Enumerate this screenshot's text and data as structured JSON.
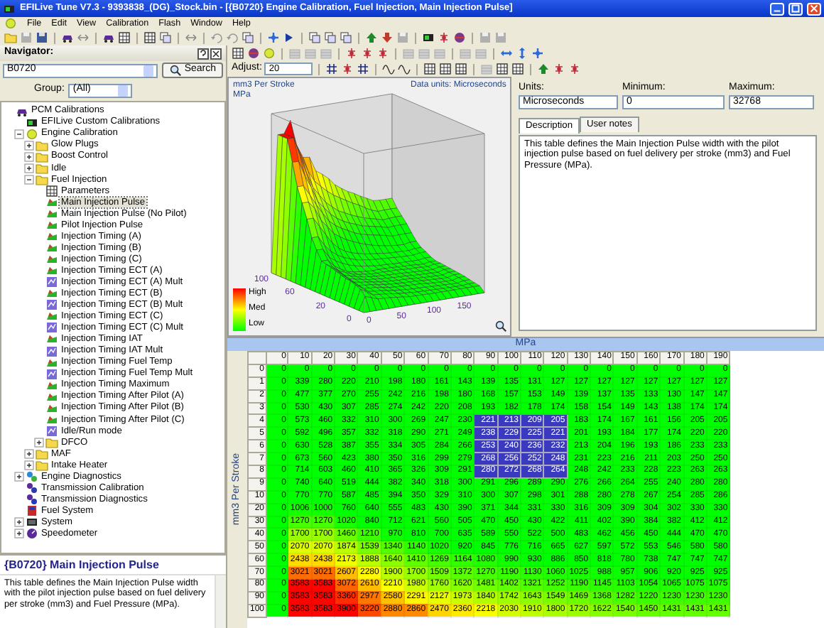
{
  "window": {
    "title": "EFILive Tune V7.3 - 9393838_(DG)_Stock.bin - [{B0720} Engine Calibration, Fuel Injection, Main Injection Pulse]"
  },
  "menu": [
    "File",
    "Edit",
    "View",
    "Calibration",
    "Flash",
    "Window",
    "Help"
  ],
  "navigator": {
    "title": "Navigator:",
    "search_value": "B0720",
    "search_button": "Search",
    "group_label": "Group:",
    "group_value": "(All)"
  },
  "tree": [
    {
      "label": "PCM Calibrations",
      "kind": "pcm",
      "selected": false,
      "children": [
        {
          "label": "EFILive Custom Calibrations",
          "kind": "custom",
          "selected": false
        },
        {
          "label": "Engine Calibration",
          "kind": "engine",
          "expanded": true,
          "selected": false,
          "children": [
            {
              "label": "Glow Plugs",
              "kind": "folder",
              "expanded": false,
              "selected": false
            },
            {
              "label": "Boost Control",
              "kind": "folder",
              "expanded": false,
              "selected": false
            },
            {
              "label": "Idle",
              "kind": "folder",
              "expanded": false,
              "selected": false
            },
            {
              "label": "Fuel Injection",
              "kind": "folder",
              "expanded": true,
              "selected": false,
              "children": [
                {
                  "label": "Parameters",
                  "kind": "grid",
                  "selected": false
                },
                {
                  "label": "Main Injection Pulse",
                  "kind": "map",
                  "selected": true
                },
                {
                  "label": "Main Injection Pulse (No Pilot)",
                  "kind": "map",
                  "selected": false
                },
                {
                  "label": "Pilot Injection Pulse",
                  "kind": "map",
                  "selected": false
                },
                {
                  "label": "Injection Timing (A)",
                  "kind": "map",
                  "selected": false
                },
                {
                  "label": "Injection Timing (B)",
                  "kind": "map",
                  "selected": false
                },
                {
                  "label": "Injection Timing (C)",
                  "kind": "map",
                  "selected": false
                },
                {
                  "label": "Injection Timing ECT (A)",
                  "kind": "map",
                  "selected": false
                },
                {
                  "label": "Injection Timing ECT (A) Mult",
                  "kind": "mult",
                  "selected": false
                },
                {
                  "label": "Injection Timing ECT (B)",
                  "kind": "map",
                  "selected": false
                },
                {
                  "label": "Injection Timing ECT (B) Mult",
                  "kind": "mult",
                  "selected": false
                },
                {
                  "label": "Injection Timing ECT (C)",
                  "kind": "map",
                  "selected": false
                },
                {
                  "label": "Injection Timing ECT (C) Mult",
                  "kind": "mult",
                  "selected": false
                },
                {
                  "label": "Injection Timing IAT",
                  "kind": "map",
                  "selected": false
                },
                {
                  "label": "Injection Timing IAT Mult",
                  "kind": "mult",
                  "selected": false
                },
                {
                  "label": "Injection Timing Fuel Temp",
                  "kind": "map",
                  "selected": false
                },
                {
                  "label": "Injection Timing Fuel Temp Mult",
                  "kind": "mult",
                  "selected": false
                },
                {
                  "label": "Injection Timing Maximum",
                  "kind": "map",
                  "selected": false
                },
                {
                  "label": "Injection Timing After Pilot (A)",
                  "kind": "map",
                  "selected": false
                },
                {
                  "label": "Injection Timing After Pilot (B)",
                  "kind": "map",
                  "selected": false
                },
                {
                  "label": "Injection Timing After Pilot (C)",
                  "kind": "map",
                  "selected": false
                },
                {
                  "label": "Idle/Run mode",
                  "kind": "mult",
                  "selected": false
                },
                {
                  "label": "DFCO",
                  "kind": "folder",
                  "expanded": false,
                  "selected": false
                }
              ]
            },
            {
              "label": "MAF",
              "kind": "folder",
              "expanded": false,
              "selected": false
            },
            {
              "label": "Intake Heater",
              "kind": "folder",
              "expanded": false,
              "selected": false
            }
          ]
        },
        {
          "label": "Engine Diagnostics",
          "kind": "diag",
          "expanded": false,
          "selected": false
        },
        {
          "label": "Transmission Calibration",
          "kind": "trans",
          "selected": false
        },
        {
          "label": "Transmission Diagnostics",
          "kind": "trans",
          "selected": false
        },
        {
          "label": "Fuel System",
          "kind": "fuel",
          "selected": false
        },
        {
          "label": "System",
          "kind": "system",
          "expanded": false,
          "selected": false
        },
        {
          "label": "Speedometer",
          "kind": "speedo",
          "expanded": false,
          "selected": false
        }
      ]
    }
  ],
  "description": {
    "heading": "{B0720} Main Injection Pulse",
    "text": "This table defines the Main Injection Pulse width with the pilot injection pulse based on fuel delivery per stroke (mm3) and Fuel Pressure (MPa)."
  },
  "adjust": {
    "label": "Adjust:",
    "value": "20"
  },
  "plot": {
    "y_label": "mm3 Per Stroke",
    "x_label": "MPa",
    "units_label": "Data units: Microseconds",
    "legend": [
      "High",
      "Med",
      "Low"
    ],
    "left_ticks": [
      "100",
      "60",
      "20",
      "0"
    ],
    "right_ticks": [
      "0",
      "50",
      "100",
      "150"
    ]
  },
  "info": {
    "units_label": "Units:",
    "units": "Microseconds",
    "min_label": "Minimum:",
    "min": "0",
    "max_label": "Maximum:",
    "max": "32768"
  },
  "tabs": [
    {
      "label": "Description",
      "selected": true
    },
    {
      "label": "User notes",
      "selected": false
    }
  ],
  "info_text": "This table defines the Main Injection Pulse width with the pilot injection pulse based on fuel delivery per stroke (mm3) and Fuel Pressure (MPa).",
  "table": {
    "x_title": "MPa",
    "y_title": "mm3 Per Stroke",
    "columns": [
      "0",
      "10",
      "20",
      "30",
      "40",
      "50",
      "60",
      "70",
      "80",
      "90",
      "100",
      "110",
      "120",
      "130",
      "140",
      "150",
      "160",
      "170",
      "180",
      "190"
    ],
    "rows": [
      {
        "label": "0",
        "cells": [
          "0",
          "0",
          "0",
          "0",
          "0",
          "0",
          "0",
          "0",
          "0",
          "0",
          "0",
          "0",
          "0",
          "0",
          "0",
          "0",
          "0",
          "0",
          "0",
          "0"
        ],
        "selected": [
          false,
          false,
          false,
          false,
          false,
          false,
          false,
          false,
          false,
          false,
          false,
          false,
          false,
          false,
          false,
          false,
          false,
          false,
          false,
          false
        ]
      },
      {
        "label": "1",
        "cells": [
          "0",
          "339",
          "280",
          "220",
          "210",
          "198",
          "180",
          "161",
          "143",
          "139",
          "135",
          "131",
          "127",
          "127",
          "127",
          "127",
          "127",
          "127",
          "127",
          "127"
        ],
        "selected": [
          false,
          false,
          false,
          false,
          false,
          false,
          false,
          false,
          false,
          false,
          false,
          false,
          false,
          false,
          false,
          false,
          false,
          false,
          false,
          false
        ]
      },
      {
        "label": "2",
        "cells": [
          "0",
          "477",
          "377",
          "270",
          "255",
          "242",
          "216",
          "198",
          "180",
          "168",
          "157",
          "153",
          "149",
          "139",
          "137",
          "135",
          "133",
          "130",
          "147",
          "147"
        ],
        "selected": [
          false,
          false,
          false,
          false,
          false,
          false,
          false,
          false,
          false,
          false,
          false,
          false,
          false,
          false,
          false,
          false,
          false,
          false,
          false,
          false
        ]
      },
      {
        "label": "3",
        "cells": [
          "0",
          "530",
          "430",
          "307",
          "285",
          "274",
          "242",
          "220",
          "208",
          "193",
          "182",
          "178",
          "174",
          "158",
          "154",
          "149",
          "143",
          "138",
          "174",
          "174"
        ],
        "selected": [
          false,
          false,
          false,
          false,
          false,
          false,
          false,
          false,
          false,
          false,
          false,
          false,
          false,
          false,
          false,
          false,
          false,
          false,
          false,
          false
        ]
      },
      {
        "label": "4",
        "cells": [
          "0",
          "573",
          "460",
          "332",
          "310",
          "300",
          "269",
          "247",
          "230",
          "221",
          "213",
          "209",
          "205",
          "183",
          "174",
          "167",
          "161",
          "156",
          "205",
          "205"
        ],
        "selected": [
          false,
          false,
          false,
          false,
          false,
          false,
          false,
          false,
          false,
          true,
          true,
          true,
          true,
          false,
          false,
          false,
          false,
          false,
          false,
          false
        ]
      },
      {
        "label": "5",
        "cells": [
          "0",
          "592",
          "496",
          "357",
          "332",
          "318",
          "290",
          "271",
          "249",
          "238",
          "229",
          "225",
          "221",
          "201",
          "193",
          "184",
          "177",
          "174",
          "220",
          "220"
        ],
        "selected": [
          false,
          false,
          false,
          false,
          false,
          false,
          false,
          false,
          false,
          true,
          true,
          true,
          true,
          false,
          false,
          false,
          false,
          false,
          false,
          false
        ]
      },
      {
        "label": "6",
        "cells": [
          "0",
          "630",
          "528",
          "387",
          "355",
          "334",
          "305",
          "284",
          "266",
          "253",
          "240",
          "236",
          "232",
          "213",
          "204",
          "196",
          "193",
          "186",
          "233",
          "233"
        ],
        "selected": [
          false,
          false,
          false,
          false,
          false,
          false,
          false,
          false,
          false,
          true,
          true,
          true,
          true,
          false,
          false,
          false,
          false,
          false,
          false,
          false
        ]
      },
      {
        "label": "7",
        "cells": [
          "0",
          "673",
          "560",
          "423",
          "380",
          "350",
          "316",
          "299",
          "279",
          "268",
          "256",
          "252",
          "248",
          "231",
          "223",
          "216",
          "211",
          "203",
          "250",
          "250"
        ],
        "selected": [
          false,
          false,
          false,
          false,
          false,
          false,
          false,
          false,
          false,
          true,
          true,
          true,
          true,
          false,
          false,
          false,
          false,
          false,
          false,
          false
        ]
      },
      {
        "label": "8",
        "cells": [
          "0",
          "714",
          "603",
          "460",
          "410",
          "365",
          "326",
          "309",
          "291",
          "280",
          "272",
          "268",
          "264",
          "248",
          "242",
          "233",
          "228",
          "223",
          "263",
          "263"
        ],
        "selected": [
          false,
          false,
          false,
          false,
          false,
          false,
          false,
          false,
          false,
          true,
          true,
          true,
          true,
          false,
          false,
          false,
          false,
          false,
          false,
          false
        ]
      },
      {
        "label": "9",
        "cells": [
          "0",
          "740",
          "640",
          "519",
          "444",
          "382",
          "340",
          "318",
          "300",
          "291",
          "296",
          "289",
          "290",
          "276",
          "266",
          "264",
          "255",
          "240",
          "280",
          "280"
        ],
        "selected": [
          false,
          false,
          false,
          false,
          false,
          false,
          false,
          false,
          false,
          false,
          false,
          false,
          false,
          false,
          false,
          false,
          false,
          false,
          false,
          false
        ]
      },
      {
        "label": "10",
        "cells": [
          "0",
          "770",
          "770",
          "587",
          "485",
          "394",
          "350",
          "329",
          "310",
          "300",
          "307",
          "298",
          "301",
          "288",
          "280",
          "278",
          "267",
          "254",
          "285",
          "286"
        ],
        "selected": [
          false,
          false,
          false,
          false,
          false,
          false,
          false,
          false,
          false,
          false,
          false,
          false,
          false,
          false,
          false,
          false,
          false,
          false,
          false,
          false
        ]
      },
      {
        "label": "20",
        "cells": [
          "0",
          "1006",
          "1000",
          "760",
          "640",
          "555",
          "483",
          "430",
          "390",
          "371",
          "344",
          "331",
          "330",
          "316",
          "309",
          "309",
          "304",
          "302",
          "330",
          "330"
        ],
        "selected": [
          false,
          false,
          false,
          false,
          false,
          false,
          false,
          false,
          false,
          false,
          false,
          false,
          false,
          false,
          false,
          false,
          false,
          false,
          false,
          false
        ]
      },
      {
        "label": "30",
        "cells": [
          "0",
          "1270",
          "1270",
          "1020",
          "840",
          "712",
          "621",
          "560",
          "505",
          "470",
          "450",
          "430",
          "422",
          "411",
          "402",
          "390",
          "384",
          "382",
          "412",
          "412"
        ],
        "selected": [
          false,
          false,
          false,
          false,
          false,
          false,
          false,
          false,
          false,
          false,
          false,
          false,
          false,
          false,
          false,
          false,
          false,
          false,
          false,
          false
        ]
      },
      {
        "label": "40",
        "cells": [
          "0",
          "1700",
          "1700",
          "1460",
          "1210",
          "970",
          "810",
          "700",
          "635",
          "589",
          "550",
          "522",
          "500",
          "483",
          "462",
          "456",
          "450",
          "444",
          "470",
          "470"
        ],
        "selected": [
          false,
          false,
          false,
          false,
          false,
          false,
          false,
          false,
          false,
          false,
          false,
          false,
          false,
          false,
          false,
          false,
          false,
          false,
          false,
          false
        ]
      },
      {
        "label": "50",
        "cells": [
          "0",
          "2070",
          "2070",
          "1874",
          "1539",
          "1340",
          "1140",
          "1020",
          "920",
          "845",
          "776",
          "716",
          "665",
          "627",
          "597",
          "572",
          "553",
          "546",
          "580",
          "580"
        ],
        "selected": [
          false,
          false,
          false,
          false,
          false,
          false,
          false,
          false,
          false,
          false,
          false,
          false,
          false,
          false,
          false,
          false,
          false,
          false,
          false,
          false
        ]
      },
      {
        "label": "60",
        "cells": [
          "0",
          "2438",
          "2438",
          "2173",
          "1888",
          "1640",
          "1410",
          "1269",
          "1164",
          "1080",
          "990",
          "930",
          "886",
          "850",
          "818",
          "780",
          "738",
          "747",
          "747",
          "747"
        ],
        "selected": [
          false,
          false,
          false,
          false,
          false,
          false,
          false,
          false,
          false,
          false,
          false,
          false,
          false,
          false,
          false,
          false,
          false,
          false,
          false,
          false
        ]
      },
      {
        "label": "70",
        "cells": [
          "0",
          "3021",
          "3021",
          "2607",
          "2280",
          "1900",
          "1700",
          "1509",
          "1372",
          "1270",
          "1190",
          "1130",
          "1060",
          "1025",
          "988",
          "957",
          "906",
          "920",
          "925",
          "925"
        ],
        "selected": [
          false,
          false,
          false,
          false,
          false,
          false,
          false,
          false,
          false,
          false,
          false,
          false,
          false,
          false,
          false,
          false,
          false,
          false,
          false,
          false
        ]
      },
      {
        "label": "80",
        "cells": [
          "0",
          "3583",
          "3583",
          "3072",
          "2610",
          "2210",
          "1980",
          "1760",
          "1620",
          "1481",
          "1402",
          "1321",
          "1252",
          "1190",
          "1145",
          "1103",
          "1054",
          "1065",
          "1075",
          "1075"
        ],
        "selected": [
          false,
          false,
          false,
          false,
          false,
          false,
          false,
          false,
          false,
          false,
          false,
          false,
          false,
          false,
          false,
          false,
          false,
          false,
          false,
          false
        ]
      },
      {
        "label": "90",
        "cells": [
          "0",
          "3583",
          "3583",
          "3360",
          "2977",
          "2580",
          "2291",
          "2127",
          "1973",
          "1840",
          "1742",
          "1643",
          "1549",
          "1469",
          "1368",
          "1282",
          "1220",
          "1230",
          "1230",
          "1230"
        ],
        "selected": [
          false,
          false,
          false,
          false,
          false,
          false,
          false,
          false,
          false,
          false,
          false,
          false,
          false,
          false,
          false,
          false,
          false,
          false,
          false,
          false
        ]
      },
      {
        "label": "100",
        "cells": [
          "0",
          "3583",
          "3583",
          "3900",
          "3220",
          "2880",
          "2860",
          "2470",
          "2360",
          "2218",
          "2030",
          "1910",
          "1800",
          "1720",
          "1622",
          "1540",
          "1450",
          "1431",
          "1431",
          "1431"
        ],
        "selected": [
          false,
          false,
          false,
          false,
          false,
          false,
          false,
          false,
          false,
          false,
          false,
          false,
          false,
          false,
          false,
          false,
          false,
          false,
          false,
          false
        ]
      }
    ]
  }
}
